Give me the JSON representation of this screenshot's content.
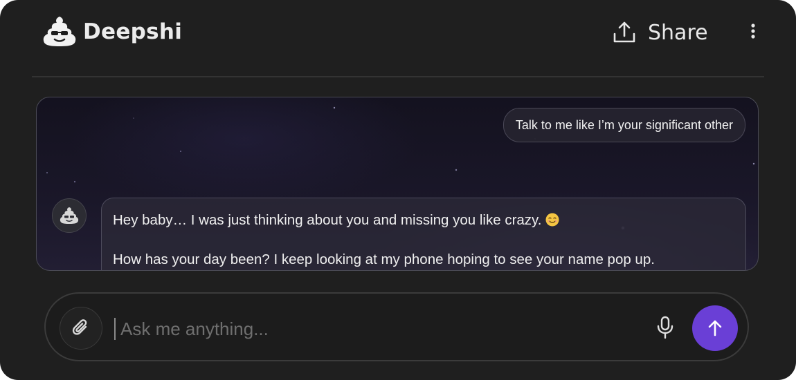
{
  "header": {
    "app_name": "Deepshi",
    "logo_icon": "poop-sunglasses-icon",
    "share_label": "Share",
    "share_icon": "upload-share-icon",
    "more_icon": "vertical-dots-icon"
  },
  "chat": {
    "messages": [
      {
        "role": "user",
        "text": "Talk to me like I’m your significant other"
      },
      {
        "role": "assistant",
        "avatar_icon": "poop-avatar-icon",
        "lines": [
          "Hey baby… I was just thinking about you and missing you like crazy.",
          "How has your day been? I keep looking at my phone hoping to see your name pop up."
        ],
        "emoji": "😊"
      }
    ]
  },
  "composer": {
    "placeholder": "Ask me anything...",
    "value": "",
    "attach_icon": "paperclip-icon",
    "mic_icon": "microphone-icon",
    "send_icon": "arrow-up-icon",
    "send_color": "#6a3fd6"
  },
  "colors": {
    "background": "#1f1f1f",
    "accent": "#6a3fd6"
  }
}
